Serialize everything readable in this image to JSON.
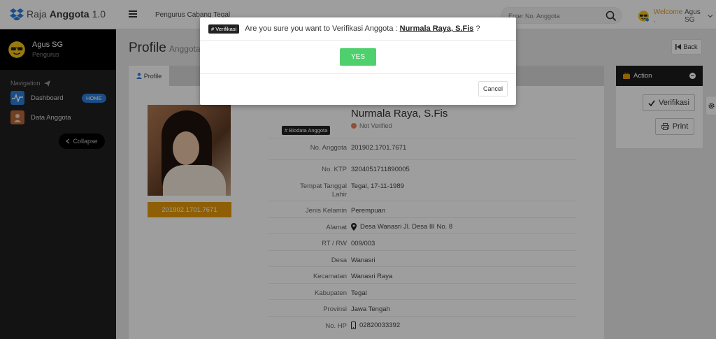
{
  "app": {
    "name_part1": "Raja",
    "name_part2": "Anggota",
    "version": "1.0"
  },
  "header": {
    "org": "Pengurus Cabang Tegal",
    "search_placeholder": "Enter No. Anggota",
    "welcome_label": "Welcome ,",
    "welcome_user": "Agus SG"
  },
  "sidebar": {
    "user_name": "Agus SG",
    "user_role": "Pengurus",
    "nav_label": "Navigation",
    "items": [
      {
        "label": "Dashboard",
        "badge": "HOME",
        "icon": "pulse-icon",
        "color": "#2d7fdc"
      },
      {
        "label": "Data Anggota",
        "icon": "member-icon",
        "color": "#b86a3a"
      }
    ],
    "collapse_label": "Collapse"
  },
  "page": {
    "title": "Profile",
    "subtitle": "Anggota",
    "back_label": "Back",
    "tab_label": "Profile"
  },
  "profile": {
    "id_number": "201902.1701.7671",
    "section_tag": "# Biodata Anggota",
    "name": "Nurmala Raya, S.Fis",
    "status": "Not Verified",
    "fields": [
      {
        "label": "No. Anggota",
        "value": "201902.1701.7671",
        "icon": ""
      },
      {
        "label": "No. KTP",
        "value": "3204051711890005",
        "icon": ""
      },
      {
        "label": "Tempat Tanggal Lahir",
        "value": "Tegal, 17-11-1989",
        "icon": ""
      },
      {
        "label": "Jenis Kelamin",
        "value": "Perempuan",
        "icon": ""
      },
      {
        "label": "Alamat",
        "value": "Desa Wanasri Jl. Desa III No. 8",
        "icon": "map-marker-icon"
      },
      {
        "label": "RT / RW",
        "value": "009/003",
        "icon": ""
      },
      {
        "label": "Desa",
        "value": "Wanasri",
        "icon": ""
      },
      {
        "label": "Kecamatan",
        "value": "Wanasri Raya",
        "icon": ""
      },
      {
        "label": "Kabupaten",
        "value": "Tegal",
        "icon": ""
      },
      {
        "label": "Provinsi",
        "value": "Jawa Tengah",
        "icon": ""
      },
      {
        "label": "No. HP",
        "value": "02820033392",
        "icon": "mobile-icon"
      }
    ]
  },
  "action": {
    "title": "Action",
    "verify_label": "Verifikasi",
    "print_label": "Print"
  },
  "modal": {
    "tag": "# Verifikasi",
    "question_prefix": "Are you sure you want to Verifikasi Anggota :",
    "member_name": "Nurmala Raya, S.Fis",
    "question_suffix": "?",
    "yes_label": "YES",
    "cancel_label": "Cancel"
  },
  "colors": {
    "accent": "#e69a0c",
    "yes_green": "#4fd06c",
    "sidebar_bg": "#1f1f1f",
    "badge_blue": "#2d7fdc"
  }
}
